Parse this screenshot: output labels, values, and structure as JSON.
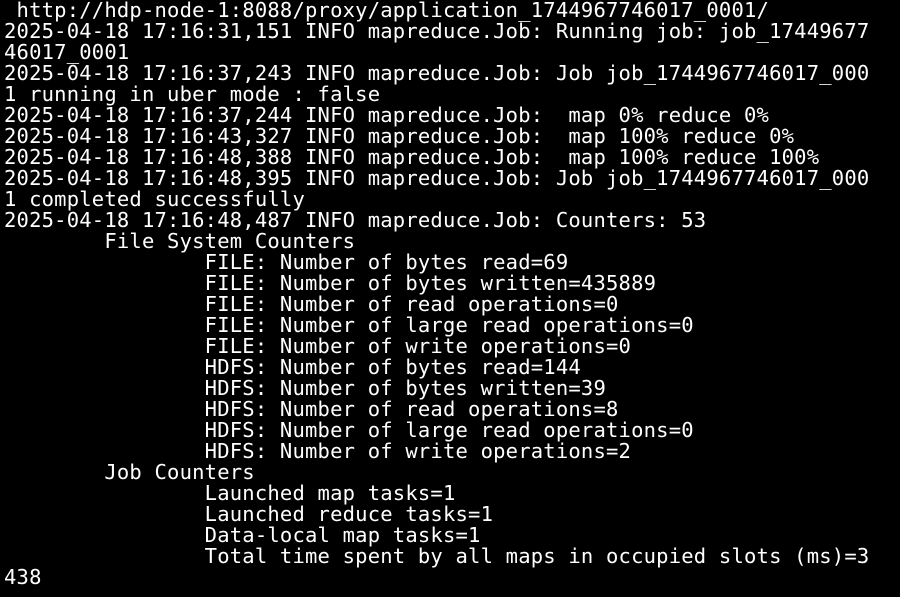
{
  "terminal": {
    "background": "#000000",
    "foreground": "#ffffff",
    "lines": [
      " http://hdp-node-1:8088/proxy/application_1744967746017_0001/",
      "2025-04-18 17:16:31,151 INFO mapreduce.Job: Running job: job_17449677",
      "46017_0001",
      "2025-04-18 17:16:37,243 INFO mapreduce.Job: Job job_1744967746017_000",
      "1 running in uber mode : false",
      "2025-04-18 17:16:37,244 INFO mapreduce.Job:  map 0% reduce 0%",
      "2025-04-18 17:16:43,327 INFO mapreduce.Job:  map 100% reduce 0%",
      "2025-04-18 17:16:48,388 INFO mapreduce.Job:  map 100% reduce 100%",
      "2025-04-18 17:16:48,395 INFO mapreduce.Job: Job job_1744967746017_000",
      "1 completed successfully",
      "2025-04-18 17:16:48,487 INFO mapreduce.Job: Counters: 53",
      "        File System Counters",
      "                FILE: Number of bytes read=69",
      "                FILE: Number of bytes written=435889",
      "                FILE: Number of read operations=0",
      "                FILE: Number of large read operations=0",
      "                FILE: Number of write operations=0",
      "                HDFS: Number of bytes read=144",
      "                HDFS: Number of bytes written=39",
      "                HDFS: Number of read operations=8",
      "                HDFS: Number of large read operations=0",
      "                HDFS: Number of write operations=2",
      "        Job Counters",
      "                Launched map tasks=1",
      "                Launched reduce tasks=1",
      "                Data-local map tasks=1",
      "                Total time spent by all maps in occupied slots (ms)=3",
      "438"
    ]
  }
}
